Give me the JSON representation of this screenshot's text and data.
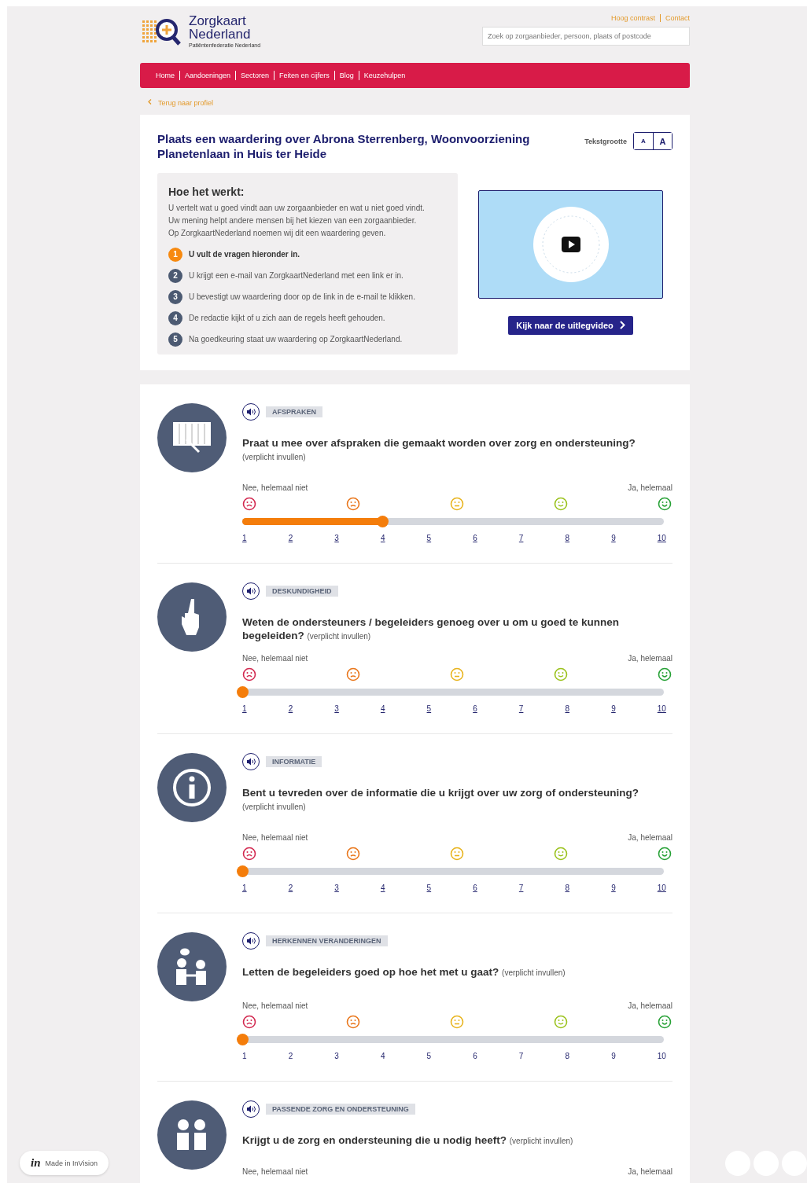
{
  "header": {
    "logo_title": "Zorgkaart",
    "logo_subtitle": "Nederland",
    "logo_tagline": "Patiëntenfederatie Nederland",
    "top_links": [
      "Hoog contrast",
      "Contact"
    ],
    "search": {
      "placeholder": "Zoek op zorgaanbieder, persoon, plaats of postcode"
    }
  },
  "nav": [
    "Home",
    "Aandoeningen",
    "Sectoren",
    "Feiten en cijfers",
    "Blog",
    "Keuzehulpen"
  ],
  "back_link": "Terug naar profiel",
  "intro": {
    "title": "Plaats een waardering over Abrona Sterrenberg, Woonvoorziening Planetenlaan in Huis ter Heide",
    "text_size_label": "Tekstgrootte",
    "text_size_buttons": [
      "A",
      "A"
    ],
    "how_title": "Hoe het werkt:",
    "how_paragraphs": [
      "U vertelt wat u goed vindt aan uw zorgaanbieder en wat u niet goed vindt.",
      "Uw mening helpt andere mensen bij het kiezen van een zorgaanbieder.",
      "Op ZorgkaartNederland noemen wij dit een waardering geven."
    ],
    "steps": [
      {
        "number": "1",
        "text": "U vult de vragen hieronder in.",
        "active": true
      },
      {
        "number": "2",
        "text": "U krijgt een e-mail van ZorgkaartNederland met een link er in.",
        "active": false
      },
      {
        "number": "3",
        "text": "U bevestigt uw waardering door op de link in de e-mail te klikken.",
        "active": false
      },
      {
        "number": "4",
        "text": "De redactie kijkt of u zich aan de regels heeft gehouden.",
        "active": false
      },
      {
        "number": "5",
        "text": "Na goedkeuring staat uw waardering op ZorgkaartNederland.",
        "active": false
      }
    ],
    "video_button": "Kijk naar de uitlegvideo"
  },
  "questions": [
    {
      "category": "AFSPRAKEN",
      "question": "Praat u mee over afspraken die gemaakt worden over zorg en ondersteuning?",
      "note": "(verplicht invullen)",
      "low_label": "Nee, helemaal niet",
      "high_label": "Ja, helemaal",
      "level": 0.333,
      "ticks_linked": true,
      "ticks": [
        "1",
        "2",
        "3",
        "4",
        "5",
        "6",
        "7",
        "8",
        "9",
        "10"
      ]
    },
    {
      "category": "DESKUNDIGHEID",
      "question": "Weten de ondersteuners / begeleiders genoeg over u om u goed te kunnen begeleiden?",
      "note": "(verplicht invullen)",
      "low_label": "Nee, helemaal niet",
      "high_label": "Ja, helemaal",
      "level": 0,
      "ticks_linked": true,
      "ticks": [
        "1",
        "2",
        "3",
        "4",
        "5",
        "6",
        "7",
        "8",
        "9",
        "10"
      ]
    },
    {
      "category": "INFORMATIE",
      "question": "Bent u tevreden over de informatie die u krijgt over uw zorg of ondersteuning?",
      "note": "(verplicht invullen)",
      "low_label": "Nee, helemaal niet",
      "high_label": "Ja, helemaal",
      "level": 0,
      "ticks_linked": true,
      "ticks": [
        "1",
        "2",
        "3",
        "4",
        "5",
        "6",
        "7",
        "8",
        "9",
        "10"
      ]
    },
    {
      "category": "HERKENNEN VERANDERINGEN",
      "question": "Letten de begeleiders goed op hoe het met u gaat?",
      "note": "(verplicht invullen)",
      "low_label": "Nee, helemaal niet",
      "high_label": "Ja, helemaal",
      "level": 0,
      "ticks_linked": false,
      "ticks": [
        "1",
        "2",
        "3",
        "4",
        "5",
        "6",
        "7",
        "8",
        "9",
        "10"
      ]
    },
    {
      "category": "PASSENDE ZORG EN ONDERSTEUNING",
      "question": "Krijgt u de zorg en ondersteuning die u nodig heeft?",
      "note": "(verplicht invullen)",
      "low_label": "Nee, helemaal niet",
      "high_label": "Ja, helemaal"
    }
  ],
  "invision_logo": "in",
  "invision_badge": "Made in InVision"
}
